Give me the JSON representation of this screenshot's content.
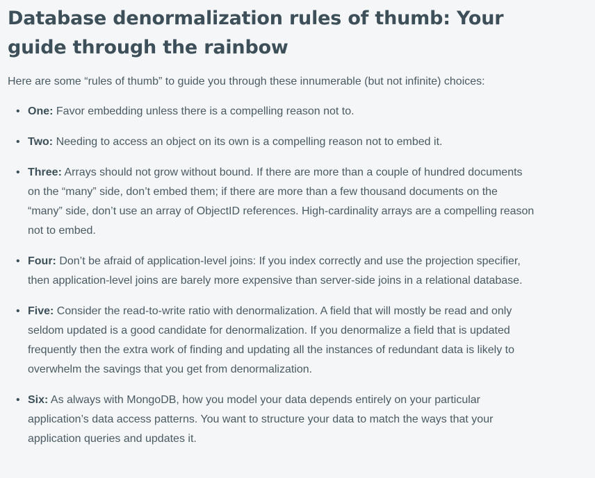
{
  "article": {
    "title": "Database denormalization rules of thumb: Your guide through the rainbow",
    "intro": "Here are some “rules of thumb” to guide you through these innumerable (but not infinite) choices:",
    "rules": [
      {
        "label": "One:",
        "text": " Favor embedding unless there is a compelling reason not to."
      },
      {
        "label": "Two:",
        "text": " Needing to access an object on its own is a compelling reason not to embed it."
      },
      {
        "label": "Three:",
        "text": " Arrays should not grow without bound. If there are more than a couple of hundred documents on the “many” side, don’t embed them; if there are more than a few thousand documents on the “many” side, don’t use an array of ObjectID references. High-cardinality arrays are a compelling reason not to embed."
      },
      {
        "label": "Four:",
        "text": " Don’t be afraid of application-level joins: If you index correctly and use the projection specifier, then application-level joins are barely more expensive than server-side joins in a relational database."
      },
      {
        "label": "Five:",
        "text": " Consider the read-to-write ratio with denormalization. A field that will mostly be read and only seldom updated is a good candidate for denormalization. If you denormalize a field that is updated frequently then the extra work of finding and updating all the instances of redundant data is likely to overwhelm the savings that you get from denormalization."
      },
      {
        "label": "Six:",
        "text": " As always with MongoDB, how you model your data depends entirely on your particular application’s data access patterns. You want to structure your data to match the ways that your application queries and updates it."
      }
    ],
    "bullet": "•"
  }
}
